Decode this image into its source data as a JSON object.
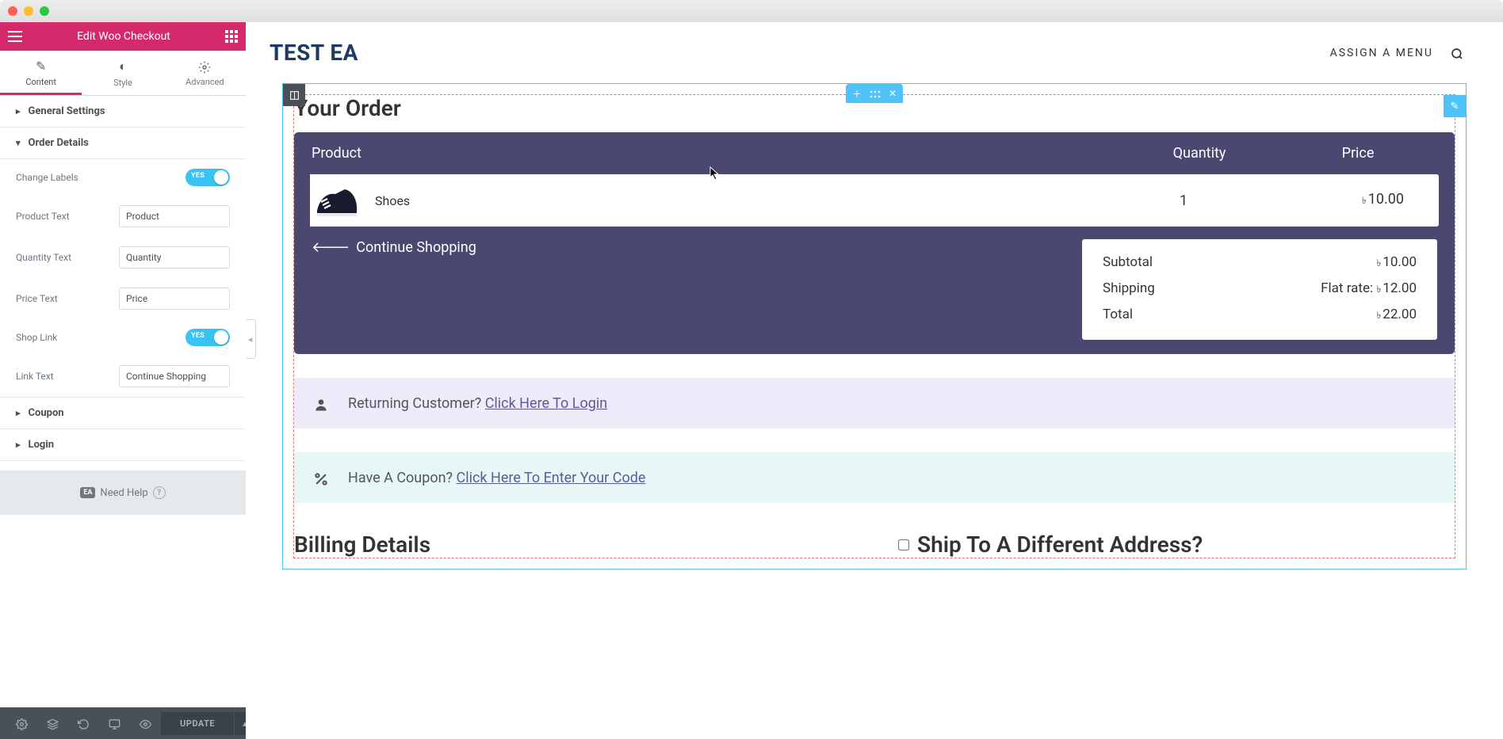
{
  "header": {
    "title": "Edit Woo Checkout"
  },
  "tabs": {
    "content": "Content",
    "style": "Style",
    "advanced": "Advanced"
  },
  "sections": {
    "general": "General Settings",
    "orderDetails": "Order Details",
    "coupon": "Coupon",
    "login": "Login"
  },
  "controls": {
    "changeLabels": {
      "label": "Change Labels",
      "value": "YES"
    },
    "productText": {
      "label": "Product Text",
      "value": "Product"
    },
    "quantityText": {
      "label": "Quantity Text",
      "value": "Quantity"
    },
    "priceText": {
      "label": "Price Text",
      "value": "Price"
    },
    "shopLink": {
      "label": "Shop Link",
      "value": "YES"
    },
    "linkText": {
      "label": "Link Text",
      "value": "Continue Shopping"
    }
  },
  "needHelp": {
    "badge": "EA",
    "text": "Need Help"
  },
  "footer": {
    "update": "UPDATE"
  },
  "site": {
    "title": "TEST EA",
    "assignMenu": "ASSIGN A MENU"
  },
  "order": {
    "title": "Your Order",
    "headers": {
      "product": "Product",
      "quantity": "Quantity",
      "price": "Price"
    },
    "item": {
      "name": "Shoes",
      "qty": "1",
      "currency": "৳",
      "price": "10.00"
    },
    "continue": "Continue Shopping",
    "totals": {
      "subtotalLabel": "Subtotal",
      "subtotalCurrency": "৳",
      "subtotalValue": "10.00",
      "shippingLabel": "Shipping",
      "shippingPrefix": "Flat rate:",
      "shippingCurrency": "৳",
      "shippingValue": "12.00",
      "totalLabel": "Total",
      "totalCurrency": "৳",
      "totalValue": "22.00"
    }
  },
  "returning": {
    "text": "Returning Customer?",
    "link": "Click Here To Login"
  },
  "couponNotice": {
    "text": "Have A Coupon?",
    "link": "Click Here To Enter Your Code"
  },
  "billing": {
    "title": "Billing Details"
  },
  "shipDiff": {
    "label": "Ship To A Different Address?"
  }
}
